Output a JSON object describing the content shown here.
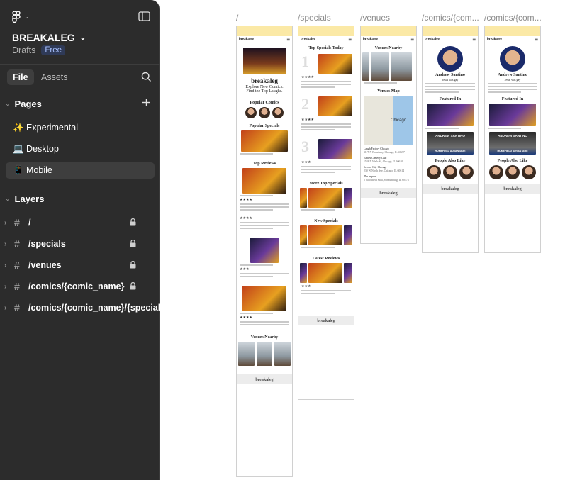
{
  "sidebar": {
    "logo_icon": "figma-logo-icon",
    "panel_toggle_icon": "panel-toggle-icon",
    "project_name": "BREAKALEG",
    "project_location": "Drafts",
    "plan_badge": "Free",
    "tabs": [
      {
        "label": "File"
      },
      {
        "label": "Assets"
      }
    ],
    "search_icon": "search-icon",
    "pages_title": "Pages",
    "add_page_icon": "plus-icon",
    "pages": [
      {
        "label": "✨ Experimental"
      },
      {
        "label": "💻 Desktop"
      },
      {
        "label": "📱 Mobile"
      }
    ],
    "layers_title": "Layers",
    "layers": [
      {
        "label": "/"
      },
      {
        "label": "/specials"
      },
      {
        "label": "/venues"
      },
      {
        "label": "/comics/{comic_name}"
      },
      {
        "label": "/comics/{comic_name}/{special_id}"
      }
    ]
  },
  "canvas": {
    "frame_labels": [
      "/",
      "/specials",
      "/venues",
      "/comics/{com...",
      "/comics/{com..."
    ],
    "home": {
      "logo": "breakaleg",
      "tagline_1": "Explore New Comics.",
      "tagline_2": "Find the Top Laughs.",
      "popular_comics": "Popular Comics",
      "popular_specials": "Popular Specials",
      "top_reviews": "Top Reviews",
      "venues_nearby": "Venues Nearby",
      "footer_logo": "breakaleg"
    },
    "specials": {
      "top_specials_today": "Top Specials Today",
      "more_top_specials": "More Top Specials",
      "new_specials": "New Specials",
      "latest_reviews": "Latest Reviews",
      "nums": [
        "1",
        "2",
        "3"
      ],
      "footer_logo": "breakaleg"
    },
    "venues": {
      "venues_nearby": "Venues Nearby",
      "venues_map": "Venues Map",
      "map_city": "Chicago",
      "list": [
        {
          "name": "Laugh Factory Chicago",
          "addr": "3175 N Broadway, Chicago, IL 60657"
        },
        {
          "name": "Zanies Comedy Club",
          "addr": "1548 N Wells St, Chicago, IL 60610"
        },
        {
          "name": "Second City Chicago",
          "addr": "230 W North Ave, Chicago, IL 60614"
        },
        {
          "name": "The Improv",
          "addr": "5 Woodfield Mall, Schaumburg, IL 60173"
        }
      ],
      "footer_logo": "breakaleg"
    },
    "comic": {
      "name": "Andrew Santino",
      "quote": "\"Jesus was gay\"",
      "featured_in": "Featured In",
      "banner": "ANDREW SANTINO",
      "banner_sub": "HOMEFIELD ADVANTAGE",
      "people_also_like": "People Also Like",
      "footer_logo": "breakaleg"
    }
  },
  "colors": {
    "sidebar_bg": "#2c2c2c",
    "badge_bg": "#2f3a57",
    "badge_text": "#a8c1ff",
    "banner_yellow": "#fbe9a6"
  }
}
